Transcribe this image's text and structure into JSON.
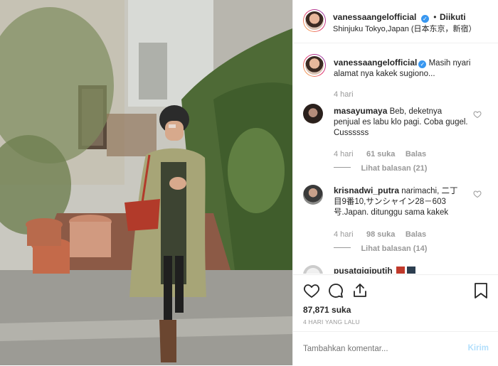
{
  "post": {
    "username": "vanessaangelofficial",
    "follow_status": "Diikuti",
    "location": "Shinjuku Tokyo,Japan (日本东京，新宿）"
  },
  "caption": {
    "username": "vanessaangelofficial",
    "text": "Masih nyari alamat nya kakek sugiono...",
    "time": "4 hari"
  },
  "comments": [
    {
      "username": "masayumaya",
      "text": "Beb, deketnya penjual es labu klo pagi. Coba gugel. Cussssss",
      "time": "4 hari",
      "likes": "61 suka",
      "reply_label": "Balas",
      "view_replies": "Lihat balasan (21)"
    },
    {
      "username": "krisnadwi_putra",
      "text": "narimachi, 二丁目9番10,サンシャイン28－603号.Japan. ditunggu sama kakek",
      "time": "4 hari",
      "likes": "98 suka",
      "reply_label": "Balas",
      "view_replies": "Lihat balasan (14)"
    },
    {
      "username": "pusatgigiputih"
    }
  ],
  "likes_count": "87,871 suka",
  "post_date": "4 HARI YANG LALU",
  "composer": {
    "placeholder": "Tambahkan komentar...",
    "submit_label": "Kirim"
  },
  "icons": [
    "verified-badge-icon",
    "heart-icon",
    "comment-icon",
    "share-icon",
    "bookmark-icon"
  ],
  "colors": {
    "accent": "#3897f0",
    "muted": "#999999",
    "border": "#efefef"
  }
}
